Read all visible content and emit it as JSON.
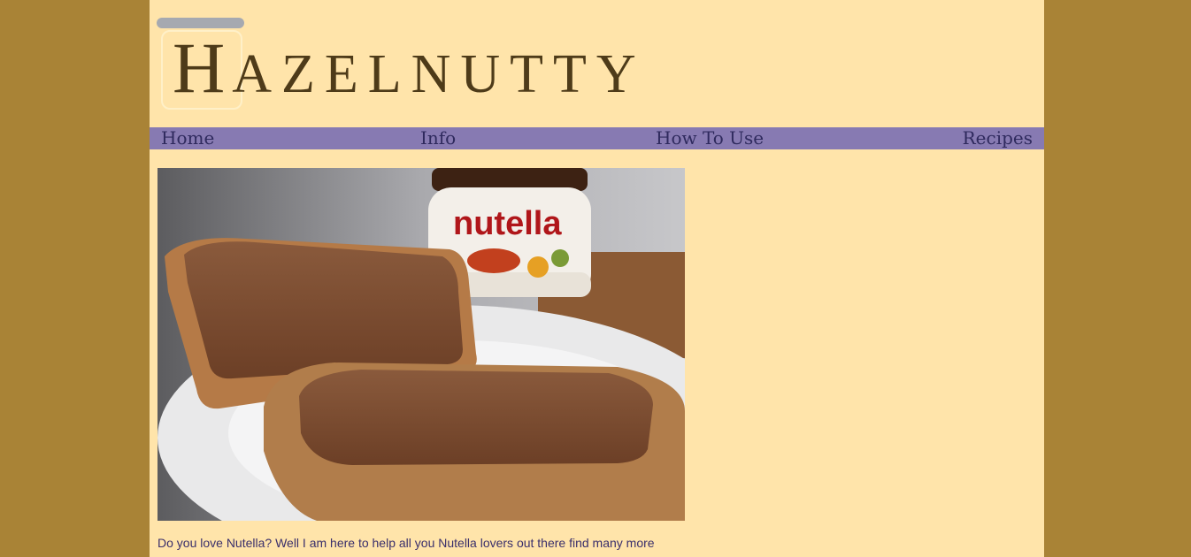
{
  "logo": {
    "initial": "H",
    "rest": "AZELNUTTY"
  },
  "nav": {
    "items": [
      {
        "label": "Home"
      },
      {
        "label": "Info"
      },
      {
        "label": "How To Use"
      },
      {
        "label": "Recipes"
      }
    ]
  },
  "hero": {
    "jar_label": "nutella"
  },
  "intro": {
    "text": "Do you love Nutella? Well I am here to help all you Nutella lovers out there find many more"
  },
  "colors": {
    "outer_background": "#a98336",
    "page_background": "#ffe4aa",
    "nav_background": "#877ab2",
    "nav_text": "#2f2a5e",
    "logo_text": "#4e3b19"
  }
}
